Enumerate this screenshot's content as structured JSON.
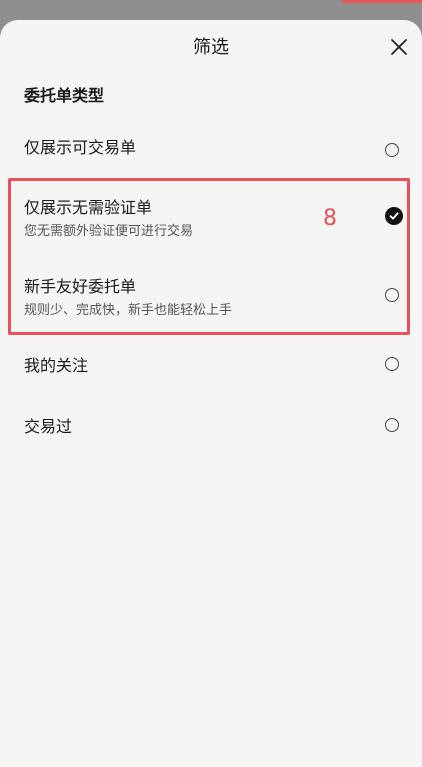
{
  "header": {
    "title": "筛选"
  },
  "section": {
    "title": "委托单类型"
  },
  "options": [
    {
      "label": "仅展示可交易单",
      "subtitle": "",
      "checked": false
    },
    {
      "label": "仅展示无需验证单",
      "subtitle": "您无需额外验证便可进行交易",
      "checked": true
    },
    {
      "label": "新手友好委托单",
      "subtitle": "规则少、完成快，新手也能轻松上手",
      "checked": false
    },
    {
      "label": "我的关注",
      "subtitle": "",
      "checked": false
    },
    {
      "label": "交易过",
      "subtitle": "",
      "checked": false
    }
  ],
  "annotation": {
    "number": "8",
    "color": "#e8505a"
  },
  "icons": {
    "close": "close-icon",
    "checkmark": "checkmark-icon"
  }
}
